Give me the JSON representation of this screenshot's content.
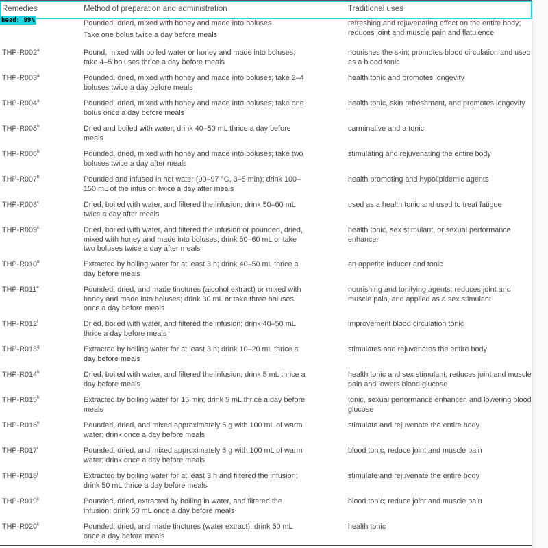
{
  "table": {
    "headers": [
      "Remedies",
      "Method of preparation and administration",
      "Traditional uses"
    ],
    "detection": {
      "label": "head: 99%"
    },
    "rows": [
      {
        "id": "",
        "sup": "",
        "method": [
          "Pounded, dried, mixed with honey and made into boluses",
          "Take one bolus twice a day before meals"
        ],
        "uses": "refreshing and rejuvenating effect on the entire body; reduces joint and muscle pain and flatulence"
      },
      {
        "id": "THP-R002",
        "sup": "a",
        "method": [
          "Pound, mixed with boiled water or honey and made into boluses; take 4–5 boluses thrice a day before meals"
        ],
        "uses": "nourishes the skin; promotes blood circulation and used as a blood tonic"
      },
      {
        "id": "THP-R003",
        "sup": "a",
        "method": [
          "Pounded, dried, mixed with honey and made into boluses; take 2–4 boluses twice a day before meals"
        ],
        "uses": "health tonic and promotes longevity"
      },
      {
        "id": "THP-R004",
        "sup": "a",
        "method": [
          "Pounded, dried, mixed with honey and made into boluses; take one bolus once a day before meals"
        ],
        "uses": "health tonic, skin refreshment, and promotes longevity"
      },
      {
        "id": "THP-R005",
        "sup": "b",
        "method": [
          "Dried and boiled with water; drink 40–50 mL thrice a day before meals"
        ],
        "uses": "carminative and a tonic"
      },
      {
        "id": "THP-R006",
        "sup": "b",
        "method": [
          "Pounded, dried, mixed with honey and made into boluses; take two boluses twice a day after meals"
        ],
        "uses": "stimulating and rejuvenating the entire body"
      },
      {
        "id": "THP-R007",
        "sup": "b",
        "method": [
          "Pounded and infused in hot water (90–97 °C, 3–5 min); drink 100–150 mL of the infusion twice a day after meals"
        ],
        "uses": "health promoting and hypolipidemic agents"
      },
      {
        "id": "THP-R008",
        "sup": "c",
        "method": [
          "Dried, boiled with water, and filtered the infusion; drink 50–60 mL twice a day after meals"
        ],
        "uses": "used as a health tonic and used to treat fatigue"
      },
      {
        "id": "THP-R009",
        "sup": "c",
        "method": [
          "Dried, boiled with water, and filtered the infusion or pounded, dried, mixed with honey and made into boluses; drink 50–60 mL or take two boluses twice a day after meals"
        ],
        "uses": "health tonic, sex stimulant, or sexual performance enhancer"
      },
      {
        "id": "THP-R010",
        "sup": "d",
        "method": [
          "Extracted by boiling water for at least 3 h; drink 40–50 mL thrice a day before meals"
        ],
        "uses": "an appetite inducer and tonic"
      },
      {
        "id": "THP-R011",
        "sup": "e",
        "method": [
          "Pounded, dried, and made tinctures (alcohol extract) or mixed with honey and made into boluses; drink 30 mL or take three boluses once a day before meals"
        ],
        "uses": "nourishing and tonifying agents; reduces joint and muscle pain, and applied as a sex stimulant"
      },
      {
        "id": "THP-R012",
        "sup": "f",
        "method": [
          "Dried, boiled with water, and filtered the infusion; drink 40–50 mL thrice a day before meals"
        ],
        "uses": "improvement blood circulation tonic"
      },
      {
        "id": "THP-R013",
        "sup": "g",
        "method": [
          "Extracted by boiling water for at least 3 h; drink 10–20 mL thrice a day before meals"
        ],
        "uses": "stimulates and rejuvenates the entire body"
      },
      {
        "id": "THP-R014",
        "sup": "h",
        "method": [
          "Dried, boiled with water, and filtered the infusion; drink 5 mL thrice a day before meals"
        ],
        "uses": "health tonic and sex stimulant; reduces joint and muscle pain and lowers blood glucose"
      },
      {
        "id": "THP-R015",
        "sup": "h",
        "method": [
          "Extracted by boiling water for 15 min; drink 5 mL thrice a day before meals"
        ],
        "uses": "tonic, sexual performance enhancer, and lowering blood glucose"
      },
      {
        "id": "THP-R016",
        "sup": "h",
        "method": [
          "Pounded, dried, and mixed approximately 5 g with 100 mL of warm water; drink once a day before meals"
        ],
        "uses": "stimulate and rejuvenate the entire body"
      },
      {
        "id": "THP-R017",
        "sup": "i",
        "method": [
          "Pounded, dried, and mixed approximately 5 g with 100 mL of warm water; drink once a day before meals"
        ],
        "uses": "blood tonic, reduce joint and muscle pain"
      },
      {
        "id": "THP-R018",
        "sup": "j",
        "method": [
          "Extracted by boiling water for at least 3 h and filtered the infusion; drink 50 mL thrice a day before meals"
        ],
        "uses": "stimulate and rejuvenate the entire body"
      },
      {
        "id": "THP-R019",
        "sup": "k",
        "method": [
          "Pounded, dried, extracted by boiling in water, and filtered the infusion; drink 50 mL once a day before meals"
        ],
        "uses": "blood tonic; reduce joint and muscle pain"
      },
      {
        "id": "THP-R020",
        "sup": "k",
        "method": [
          "Pounded, dried, and made tinctures (water extract); drink 50 mL once a day before meals"
        ],
        "uses": "health tonic"
      }
    ]
  }
}
